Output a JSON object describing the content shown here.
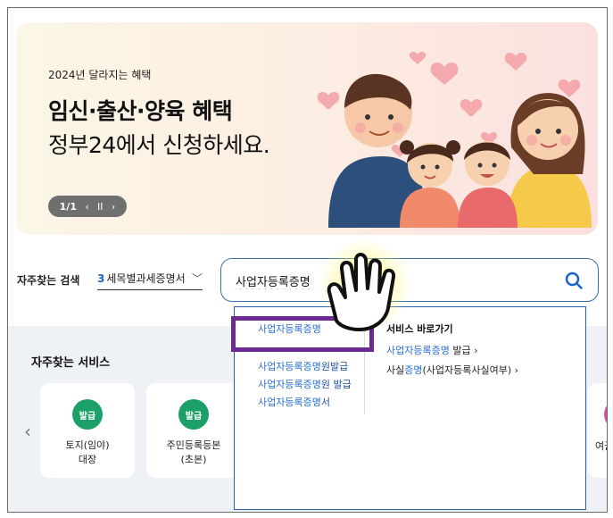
{
  "banner": {
    "subtitle": "2024년 달라지는 혜택",
    "title": "임신·출산·양육 혜택",
    "title2": "정부24에서 신청하세요.",
    "pager_num": "1/1",
    "pager_prev": "‹",
    "pager_pause": "II",
    "pager_next": "›"
  },
  "search": {
    "label": "자주찾는 검색",
    "select_count": "3",
    "select_text": "세목별과세증명서",
    "select_chevron": "﹀",
    "query": "사업자등록증명"
  },
  "dropdown": {
    "suggestions": [
      {
        "hl": "사업자등록증명",
        "rest": ""
      },
      {
        "hl": "사업자등록증명",
        "rest": "원발급"
      },
      {
        "hl": "사업자등록증명",
        "rest": "원 발급"
      },
      {
        "hl": "사업자등록증명",
        "rest": "서"
      }
    ],
    "service_title": "서비스 바로가기",
    "services": [
      {
        "pre": "",
        "hl": "사업자등록증명",
        "rest": " 발급",
        "arrow": "›"
      },
      {
        "pre": "사실",
        "hl": "증명",
        "rest": "(사업자등록사실여부)",
        "arrow": "›"
      }
    ]
  },
  "frequent": {
    "title": "자주찾는 서비스",
    "prev": "‹",
    "cards": [
      {
        "badge": "발급",
        "label": "토지(임야)\n대장"
      },
      {
        "badge": "발급",
        "label": "주민등록등본\n(초본)"
      }
    ],
    "edge_label": "여권"
  },
  "colors": {
    "accent_blue": "#2a6fd6",
    "badge_green": "#1aa068",
    "highlight_purple": "#6b2a8f"
  }
}
